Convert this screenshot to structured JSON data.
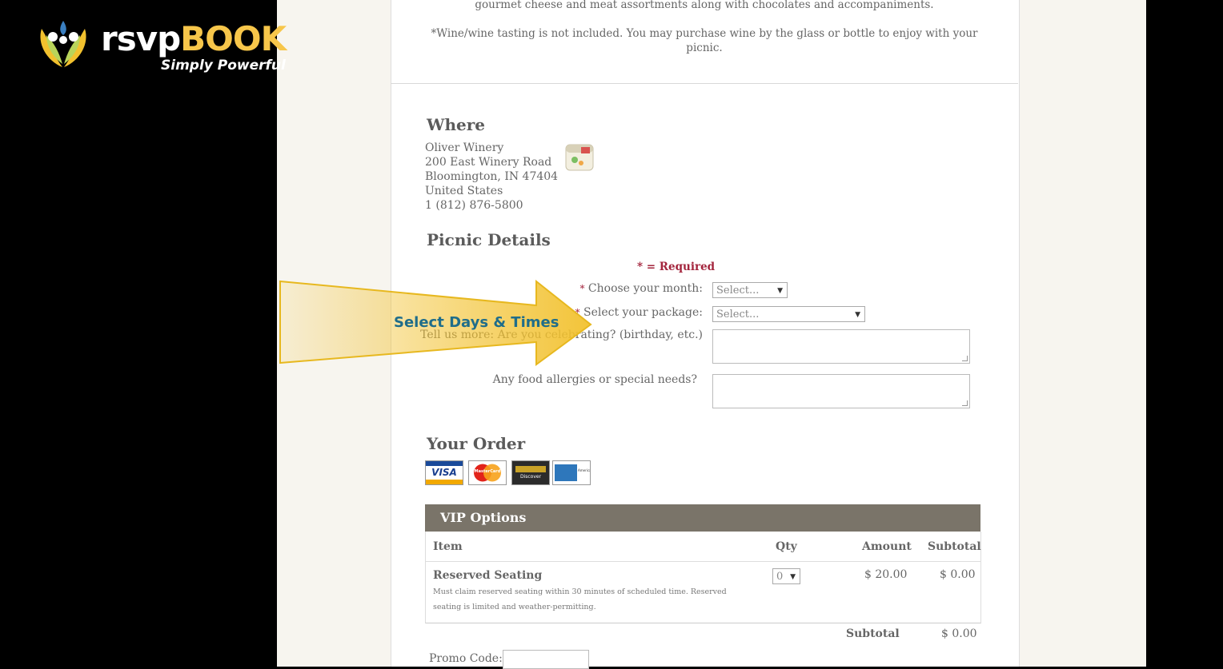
{
  "logo": {
    "brand_part1": "rsvp",
    "brand_part2": "BOOK",
    "tagline": "Simply Powerful"
  },
  "description": {
    "line1": "gourmet cheese and meat assortments along with chocolates and accompaniments.",
    "wine_note_line1": "*Wine/wine tasting is not included. You may purchase wine by the glass or bottle to enjoy with your",
    "wine_note_line2": "picnic."
  },
  "where": {
    "heading": "Where",
    "address_lines": [
      "Oliver Winery",
      "200 East Winery Road",
      "Bloomington, IN 47404",
      "United States",
      "1 (812) 876-5800"
    ],
    "icon": "calendar-icon"
  },
  "details": {
    "heading": "Picnic Details",
    "required_note": "* = Required",
    "month_label": "Choose your month:",
    "month_value": "Select...",
    "package_label": "Select your package:",
    "package_value": "Select...",
    "celebrating_label": "Tell us more: Are you celebrating? (birthday, etc.)",
    "allergies_label": "Any food allergies or special needs?"
  },
  "order": {
    "heading": "Your Order",
    "cards": [
      "VISA",
      "MasterCard",
      "Discover",
      "American Express"
    ],
    "table_title": "VIP Options",
    "columns": {
      "item": "Item",
      "qty": "Qty",
      "amount": "Amount",
      "subtotal": "Subtotal"
    },
    "rows": [
      {
        "item": "Reserved Seating",
        "note_line1": "Must claim reserved seating within 30 minutes of scheduled time. Reserved",
        "note_line2": "seating is limited and weather-permitting.",
        "qty": "0",
        "amount": "$ 20.00",
        "subtotal": "$ 0.00"
      }
    ],
    "subtotal_label": "Subtotal",
    "subtotal_value": "$ 0.00",
    "promo_label": "Promo Code:"
  },
  "overlay": {
    "arrow_text": "Select Days & Times",
    "color": "#f2c12e"
  }
}
